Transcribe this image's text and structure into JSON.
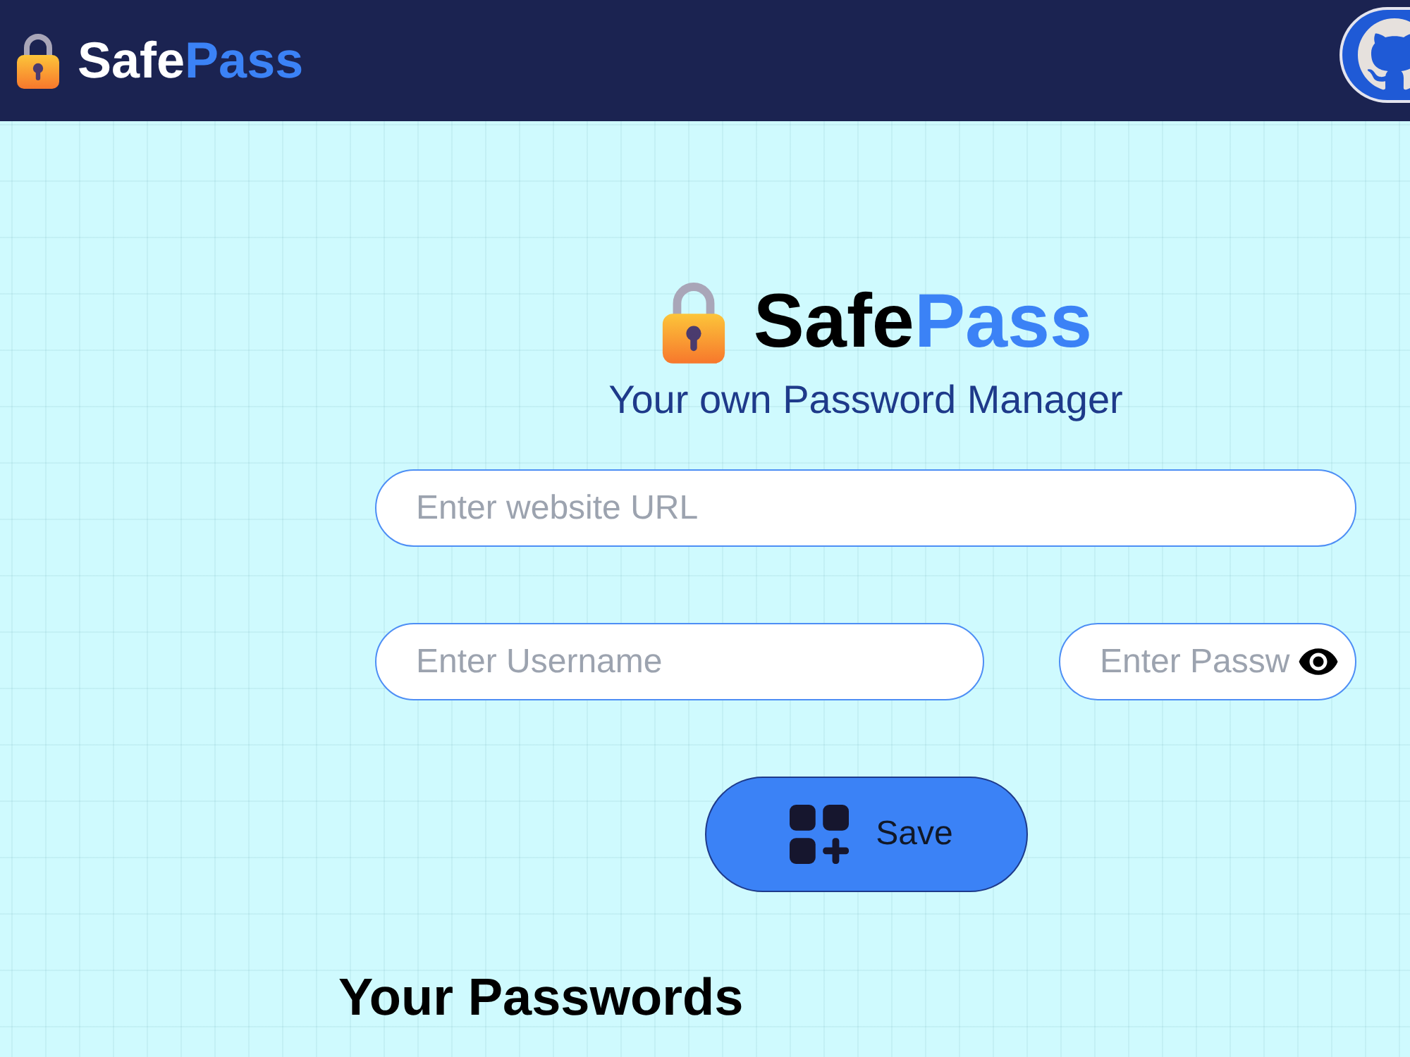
{
  "navbar": {
    "logo": {
      "name_start": "Safe",
      "name_end": "Pass"
    }
  },
  "header": {
    "title": {
      "name_start": "Safe",
      "name_end": "Pass"
    },
    "tagline": "Your own Password Manager"
  },
  "form": {
    "fields": [
      {
        "kind": "url",
        "placeholder": "Enter website URL"
      },
      {
        "kind": "text",
        "placeholder": "Enter Username"
      },
      {
        "kind": "password",
        "placeholder": "Enter Passw"
      }
    ],
    "save_button": {
      "label": "Save"
    }
  },
  "passwords": {
    "title": "Your Passwords"
  }
}
